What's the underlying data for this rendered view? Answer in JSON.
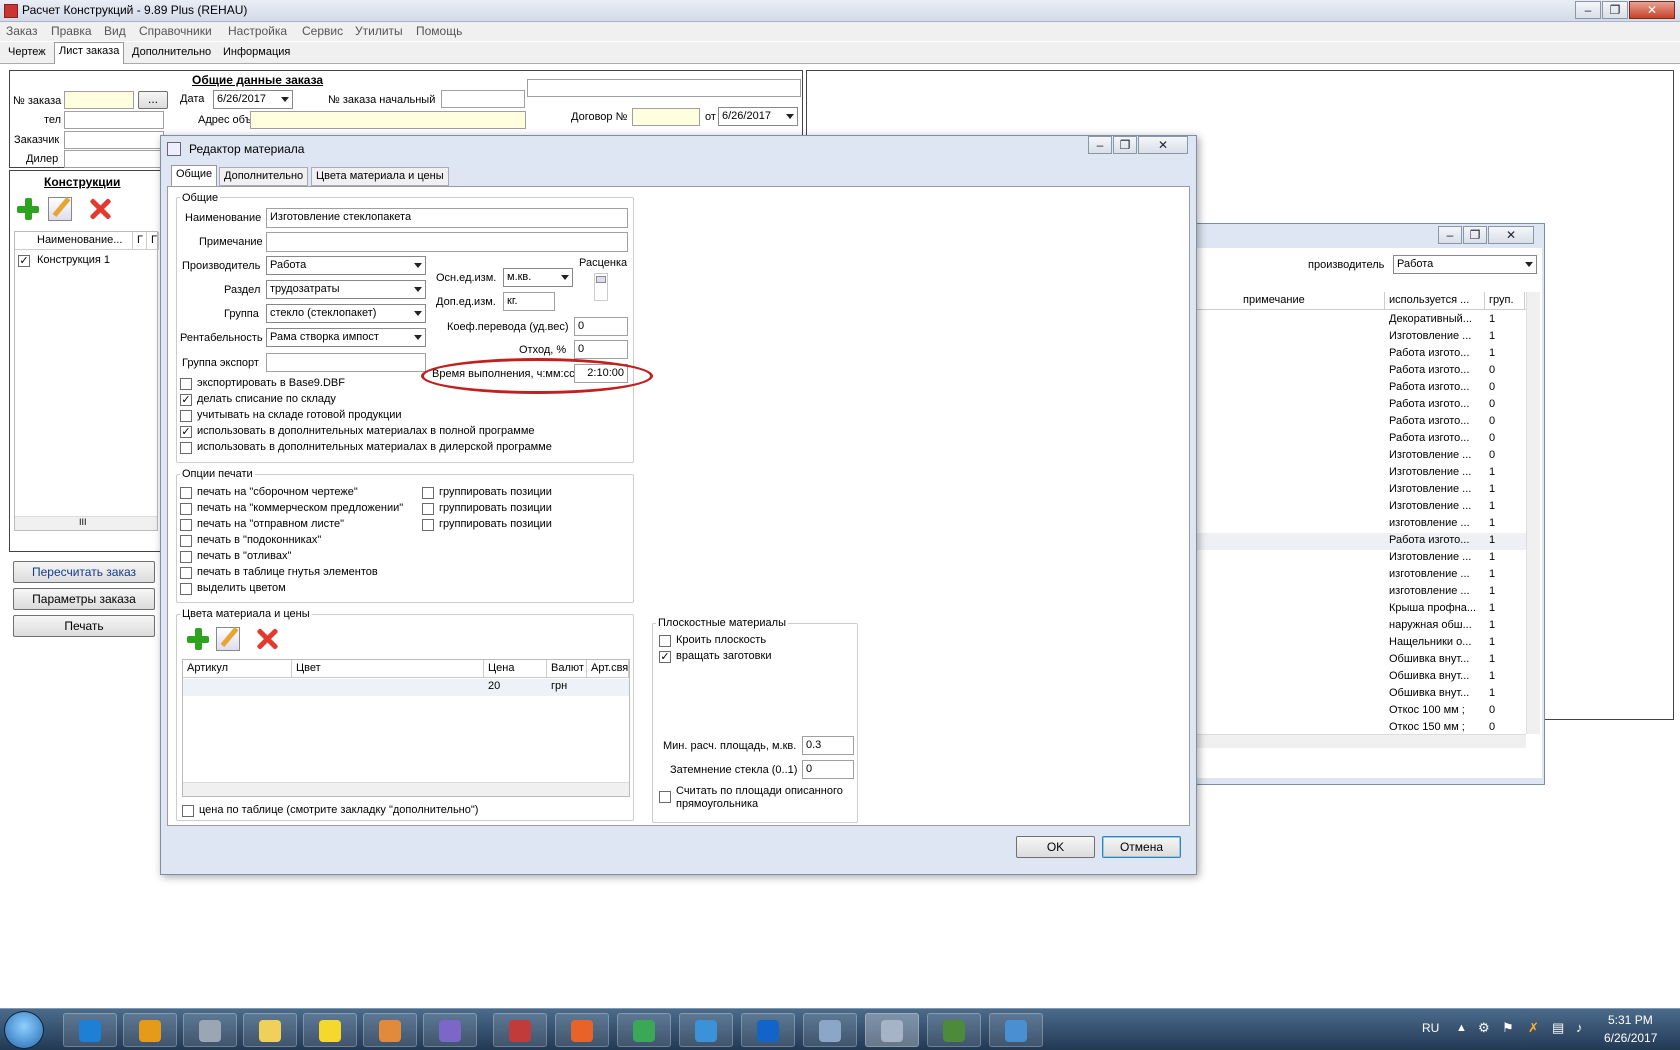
{
  "window": {
    "title": "Расчет Конструкций - 9.89 Plus (REHAU)"
  },
  "menu": [
    "Заказ",
    "Правка",
    "Вид",
    "Справочники",
    "Настройка",
    "Сервис",
    "Утилиты",
    "Помощь"
  ],
  "tabs": [
    "Чертеж",
    "Лист заказа",
    "Дополнительно",
    "Информация"
  ],
  "order": {
    "header": "Общие данные заказа",
    "num_label": "№ заказа",
    "browse": "...",
    "date_label": "Дата",
    "date": "6/26/2017",
    "start_num_label": "№ заказа начальный",
    "tel_label": "тел",
    "address_label": "Адрес объекта",
    "customer_label": "Заказчик",
    "dealer_label": "Дилер",
    "contract_label": "Договор №",
    "from_label": "от",
    "contract_date": "6/26/2017"
  },
  "constructions": {
    "title": "Конструкции",
    "col_name": "Наименование...",
    "col_g1": "Г",
    "col_g2": "Г",
    "rows": [
      {
        "checked": "✓",
        "name": "Конструкция 1"
      }
    ],
    "scroll_mid": "III"
  },
  "left_buttons": {
    "recalc": "Пересчитать заказ",
    "params": "Параметры заказа",
    "print": "Печать"
  },
  "bg_window": {
    "producer_label": "производитель",
    "producer": "Работа",
    "col_note": "примечание",
    "col_used": "используется ...",
    "col_group": "груп.",
    "rows": [
      {
        "used": "Декоративный...",
        "group": "1"
      },
      {
        "used": "Изготовление ...",
        "group": "1"
      },
      {
        "used": "Работа изгото...",
        "group": "1"
      },
      {
        "used": "Работа изгото...",
        "group": "0"
      },
      {
        "used": "Работа изгото...",
        "group": "0"
      },
      {
        "used": "Работа изгото...",
        "group": "0"
      },
      {
        "used": "Работа изгото...",
        "group": "0"
      },
      {
        "used": "Работа изгото...",
        "group": "0"
      },
      {
        "used": "Изготовление ...",
        "group": "0"
      },
      {
        "used": "Изготовление ...",
        "group": "1"
      },
      {
        "used": "Изготовление ...",
        "group": "1"
      },
      {
        "used": "Изготовление ...",
        "group": "1"
      },
      {
        "used": "изготовление ...",
        "group": "1"
      },
      {
        "used": "Работа изгото...",
        "group": "1"
      },
      {
        "used": "Изготовление ...",
        "group": "1"
      },
      {
        "used": "изготовление ...",
        "group": "1"
      },
      {
        "used": "изготовление ...",
        "group": "1"
      },
      {
        "used": "Крыша профна...",
        "group": "1"
      },
      {
        "used": "наружная обш...",
        "group": "1"
      },
      {
        "used": "Нащельники о...",
        "group": "1"
      },
      {
        "used": "Обшивка внут...",
        "group": "1"
      },
      {
        "used": "Обшивка внут...",
        "group": "1"
      },
      {
        "used": "Обшивка внут...",
        "group": "1"
      },
      {
        "used": "Откос 100 мм ;",
        "group": "0"
      },
      {
        "used": "Откос 150 мм ;",
        "group": "0"
      }
    ]
  },
  "dialog": {
    "title": "Редактор материала",
    "tabs": [
      "Общие",
      "Дополнительно",
      "Цвета материала и цены"
    ],
    "general_group": "Общие",
    "name_label": "Наименование",
    "name_value": "Изготовление стеклопакета",
    "note_label": "Примечание",
    "producer_label": "Производитель",
    "producer_value": "Работа",
    "section_label": "Раздел",
    "section_value": "трудозатраты",
    "group_label": "Группа",
    "group_value": "стекло (стеклопакет)",
    "profit_label": "Рентабельность",
    "profit_value": "Рама створка импост",
    "export_group_label": "Группа экспорт",
    "main_unit_label": "Осн.ед.изм.",
    "main_unit_value": "м.кв.",
    "extra_unit_label": "Доп.ед.изм.",
    "extra_unit_value": "кг.",
    "rate_label": "Расценка",
    "coef_label": "Коеф.перевода (уд.вес)",
    "coef_value": "0",
    "waste_label": "Отход, %",
    "waste_value": "0",
    "time_label": "Время выполнения, ч:мм:сс",
    "time_value": "2:10:00",
    "checks": [
      {
        "label": "экспортировать в Base9.DBF",
        "mark": ""
      },
      {
        "label": "делать списание по складу",
        "mark": "✓"
      },
      {
        "label": "учитывать на складе готовой продукции",
        "mark": ""
      },
      {
        "label": "использовать в дополнительных материалах в полной программе",
        "mark": "✓"
      },
      {
        "label": "использовать в дополнительных материалах в дилерской программе",
        "mark": ""
      }
    ],
    "print_group": "Опции печати",
    "print_left": [
      "печать на \"сборочном чертеже\"",
      "печать на \"коммерческом предложении\"",
      "печать на \"отправном листе\"",
      "печать в \"подоконниках\"",
      "печать в \"отливах\"",
      "печать в таблице гнутья элементов",
      "выделить цветом"
    ],
    "print_right": [
      "группировать позиции",
      "группировать позиции",
      "группировать позиции"
    ],
    "colors_group": "Цвета материала и цены",
    "colors_cols": [
      "Артикул",
      "Цвет",
      "Цена",
      "Валют",
      "Арт.свя"
    ],
    "colors_row": {
      "price": "20",
      "currency": "грн"
    },
    "table_price_label": "цена по таблице (смотрите закладку \"дополнительно\")",
    "flat_group": "Плоскостные материалы",
    "flat_checks": [
      {
        "label": "Кроить плоскость",
        "mark": ""
      },
      {
        "label": "вращать заготовки",
        "mark": "✓"
      }
    ],
    "min_area_label": "Мин. расч. площадь, м.кв.",
    "min_area_value": "0.3",
    "shade_label": "Затемнение стекла (0..1)",
    "shade_value": "0",
    "rect_area_label": "Считать по площади описанного прямоугольника",
    "ok": "OK",
    "cancel": "Отмена"
  },
  "tray": {
    "lang": "RU",
    "time": "5:31 PM",
    "date": "6/26/2017"
  }
}
